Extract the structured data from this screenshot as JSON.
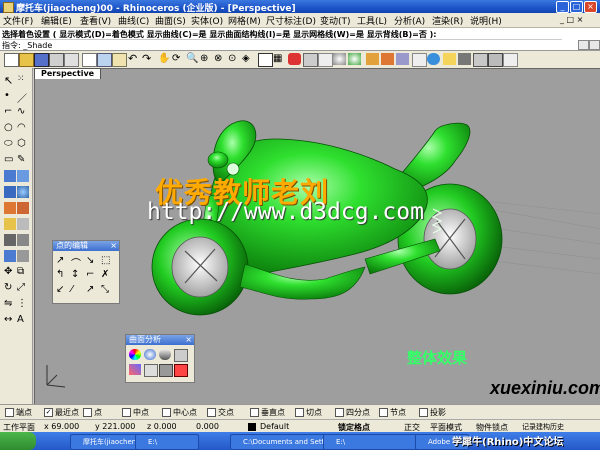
{
  "window": {
    "title": "摩托车(jiaocheng)00 - Rhinoceros (企业版) - [Perspective]",
    "controls": [
      "_",
      "□",
      "×"
    ]
  },
  "menu": [
    "文件(F)",
    "编辑(E)",
    "查看(V)",
    "曲线(C)",
    "曲面(S)",
    "实体(O)",
    "网格(M)",
    "尺寸标注(D)",
    "变动(T)",
    "工具(L)",
    "分析(A)",
    "渲染(R)",
    "说明(H)"
  ],
  "command": {
    "line1": "选择着色设置 ( 显示模式(D)=着色模式  显示曲线(C)=是  显示曲面结构线(I)=是  显示网格线(W)=是  显示背线(B)=否 ):",
    "line2": "指令: _Shade"
  },
  "viewport": {
    "tab_label": "Perspective",
    "watermark_cn": "优秀教师老刘",
    "watermark_url": "http://www.d3dcg.com",
    "caption": "整体效果",
    "brand_domain": "xuexiniu.com",
    "brand_sub": "学犀牛(Rhino)中文论坛"
  },
  "panels": {
    "points": {
      "title": "点的编辑",
      "close": "×"
    },
    "surface_analysis": {
      "title": "曲面分析",
      "close": "×"
    }
  },
  "osnap": [
    {
      "label": "端点",
      "checked": false
    },
    {
      "label": "最近点",
      "checked": true
    },
    {
      "label": "点",
      "checked": false
    },
    {
      "label": "中点",
      "checked": false
    },
    {
      "label": "中心点",
      "checked": false
    },
    {
      "label": "交点",
      "checked": false
    },
    {
      "label": "垂直点",
      "checked": false
    },
    {
      "label": "切点",
      "checked": false
    },
    {
      "label": "四分点",
      "checked": false
    },
    {
      "label": "节点",
      "checked": false
    },
    {
      "label": "投影",
      "checked": false
    }
  ],
  "status": {
    "plane": "工作平面",
    "x": "x 69.000",
    "y": "y 221.000",
    "z": "z 0.000",
    "delta": "0.000",
    "layer": "Default",
    "snap": "锁定格点",
    "ortho": "正交",
    "planar": "平面模式",
    "osnap": "物件锁点",
    "history": "记录建构历史"
  },
  "taskbar": {
    "items": [
      "摩托车(jiaocheng)00 -...",
      "E:\\",
      "C:\\Documents and Sett...",
      "E:\\",
      "Adobe Photoshop"
    ]
  },
  "colors": {
    "model_green": "#22dd22",
    "watermark_orange": "#ffaa00",
    "viewport_bg": "#9e9e9e",
    "xp_blue": "#2458c8"
  }
}
